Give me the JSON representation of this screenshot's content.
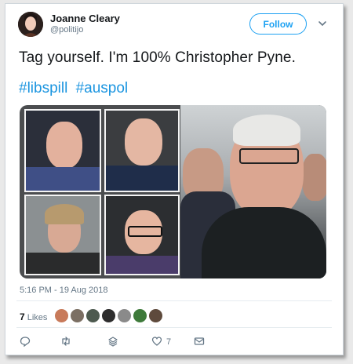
{
  "user": {
    "name": "Joanne Cleary",
    "handle": "@politijo"
  },
  "header": {
    "follow_label": "Follow"
  },
  "tweet": {
    "text": "Tag yourself. I'm 100% Christopher Pyne.",
    "hashtags": [
      "#libspill",
      "#auspol"
    ],
    "timestamp": "5:16 PM - 19 Aug 2018"
  },
  "engagement": {
    "likes_count": "7",
    "likes_label": "Likes",
    "like_action_count": "7"
  },
  "icons": [
    "chevron-down-icon",
    "reply-icon",
    "retweet-icon",
    "stack-icon",
    "heart-icon",
    "message-icon"
  ],
  "colors": {
    "accent": "#1da1f2",
    "hashtag": "#1b95e0",
    "secondary_text": "#657786"
  }
}
